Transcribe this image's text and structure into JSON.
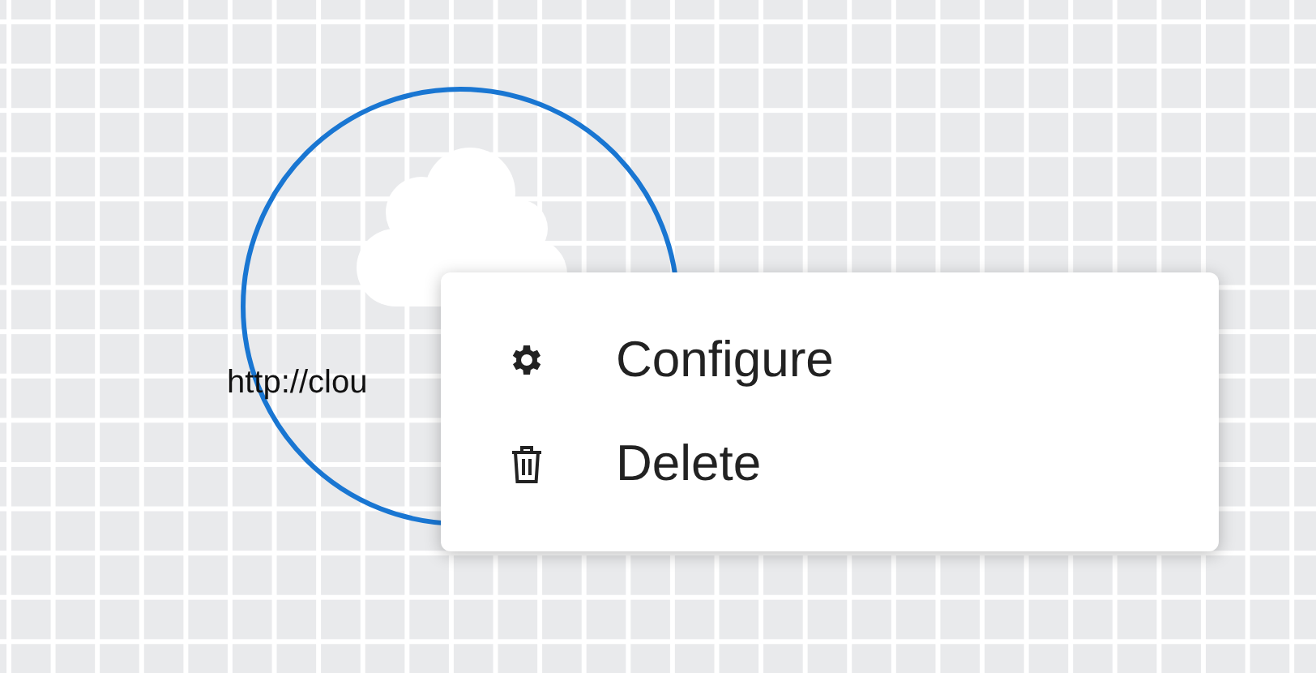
{
  "node": {
    "label": "http://clou",
    "selected": true
  },
  "context_menu": {
    "items": [
      {
        "label": "Configure",
        "kind": "configure"
      },
      {
        "label": "Delete",
        "kind": "delete"
      }
    ]
  }
}
